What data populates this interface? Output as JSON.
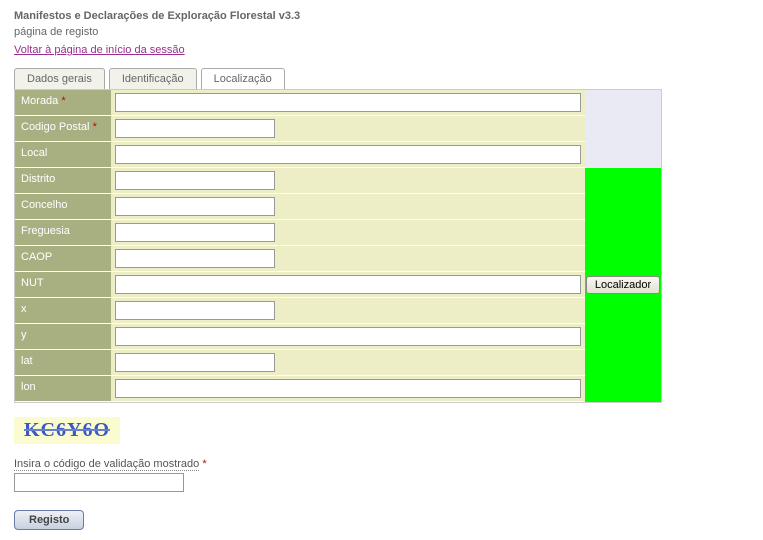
{
  "header": {
    "title": "Manifestos e Declarações de Exploração Florestal v3.3",
    "subtitle": "página de registo",
    "back_link": "Voltar à página de início da sessão"
  },
  "tabs": {
    "t1": "Dados gerais",
    "t2": "Identificação",
    "t3": "Localização"
  },
  "form": {
    "morada": {
      "label": "Morada",
      "value": "",
      "required": true
    },
    "codigo_postal": {
      "label": "Codigo Postal",
      "value": "",
      "required": true
    },
    "local": {
      "label": "Local",
      "value": ""
    },
    "distrito": {
      "label": "Distrito",
      "value": ""
    },
    "concelho": {
      "label": "Concelho",
      "value": ""
    },
    "freguesia": {
      "label": "Freguesia",
      "value": ""
    },
    "caop": {
      "label": "CAOP",
      "value": ""
    },
    "nut": {
      "label": "NUT",
      "value": ""
    },
    "x": {
      "label": "x",
      "value": ""
    },
    "y": {
      "label": "y",
      "value": ""
    },
    "lat": {
      "label": "lat",
      "value": ""
    },
    "lon": {
      "label": "lon",
      "value": ""
    }
  },
  "localizador_btn": "Localizador",
  "captcha_text": "KC6Y6O",
  "validation_label": "Insira o código de validação mostrado",
  "validation_value": "",
  "submit_label": "Registo"
}
